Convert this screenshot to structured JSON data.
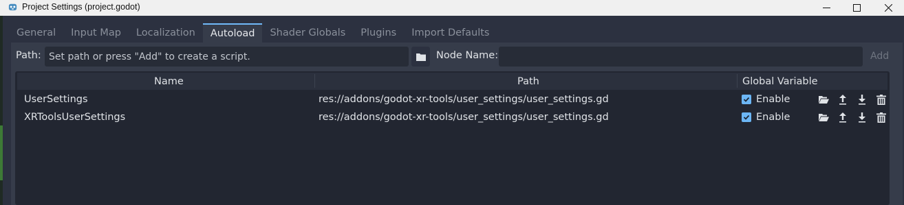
{
  "window": {
    "title": "Project Settings (project.godot)"
  },
  "tabs": [
    {
      "label": "General"
    },
    {
      "label": "Input Map"
    },
    {
      "label": "Localization"
    },
    {
      "label": "Autoload",
      "active": true
    },
    {
      "label": "Shader Globals"
    },
    {
      "label": "Plugins"
    },
    {
      "label": "Import Defaults"
    }
  ],
  "path_row": {
    "path_label": "Path:",
    "path_placeholder": "Set path or press \"Add\" to create a script.",
    "node_name_label": "Node Name:",
    "node_name_value": "",
    "add_label": "Add"
  },
  "table": {
    "headers": {
      "name": "Name",
      "path": "Path",
      "global": "Global Variable"
    },
    "rows": [
      {
        "name": "UserSettings",
        "path": "res://addons/godot-xr-tools/user_settings/user_settings.gd",
        "global_enabled": true,
        "enable_label": "Enable"
      },
      {
        "name": "XRToolsUserSettings",
        "path": "res://addons/godot-xr-tools/user_settings/user_settings.gd",
        "global_enabled": true,
        "enable_label": "Enable"
      }
    ],
    "row_icons": [
      "open-folder-icon",
      "move-up-icon",
      "move-down-icon",
      "delete-icon"
    ]
  },
  "colors": {
    "accent": "#70bafa",
    "checkbox": "#6cb6f5",
    "panel_bg": "#363c4a",
    "table_bg": "#222631"
  }
}
